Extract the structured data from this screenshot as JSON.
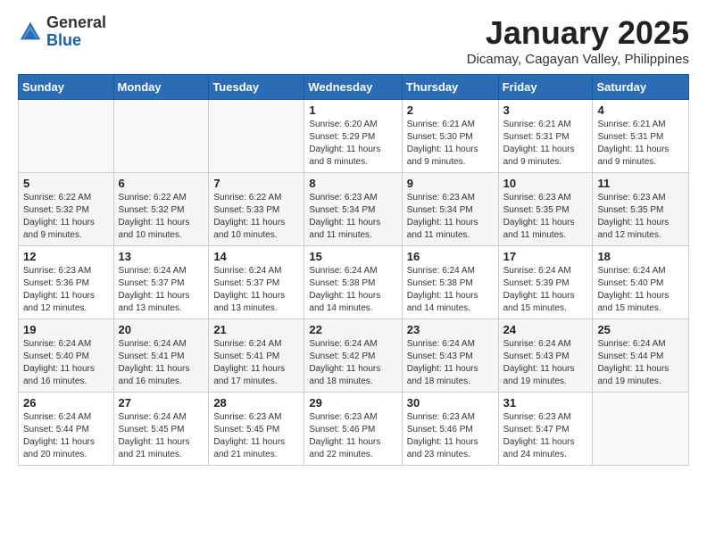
{
  "header": {
    "logo_general": "General",
    "logo_blue": "Blue",
    "month_title": "January 2025",
    "location": "Dicamay, Cagayan Valley, Philippines"
  },
  "days_of_week": [
    "Sunday",
    "Monday",
    "Tuesday",
    "Wednesday",
    "Thursday",
    "Friday",
    "Saturday"
  ],
  "weeks": [
    [
      {
        "day": "",
        "info": ""
      },
      {
        "day": "",
        "info": ""
      },
      {
        "day": "",
        "info": ""
      },
      {
        "day": "1",
        "info": "Sunrise: 6:20 AM\nSunset: 5:29 PM\nDaylight: 11 hours\nand 8 minutes."
      },
      {
        "day": "2",
        "info": "Sunrise: 6:21 AM\nSunset: 5:30 PM\nDaylight: 11 hours\nand 9 minutes."
      },
      {
        "day": "3",
        "info": "Sunrise: 6:21 AM\nSunset: 5:31 PM\nDaylight: 11 hours\nand 9 minutes."
      },
      {
        "day": "4",
        "info": "Sunrise: 6:21 AM\nSunset: 5:31 PM\nDaylight: 11 hours\nand 9 minutes."
      }
    ],
    [
      {
        "day": "5",
        "info": "Sunrise: 6:22 AM\nSunset: 5:32 PM\nDaylight: 11 hours\nand 9 minutes."
      },
      {
        "day": "6",
        "info": "Sunrise: 6:22 AM\nSunset: 5:32 PM\nDaylight: 11 hours\nand 10 minutes."
      },
      {
        "day": "7",
        "info": "Sunrise: 6:22 AM\nSunset: 5:33 PM\nDaylight: 11 hours\nand 10 minutes."
      },
      {
        "day": "8",
        "info": "Sunrise: 6:23 AM\nSunset: 5:34 PM\nDaylight: 11 hours\nand 11 minutes."
      },
      {
        "day": "9",
        "info": "Sunrise: 6:23 AM\nSunset: 5:34 PM\nDaylight: 11 hours\nand 11 minutes."
      },
      {
        "day": "10",
        "info": "Sunrise: 6:23 AM\nSunset: 5:35 PM\nDaylight: 11 hours\nand 11 minutes."
      },
      {
        "day": "11",
        "info": "Sunrise: 6:23 AM\nSunset: 5:35 PM\nDaylight: 11 hours\nand 12 minutes."
      }
    ],
    [
      {
        "day": "12",
        "info": "Sunrise: 6:23 AM\nSunset: 5:36 PM\nDaylight: 11 hours\nand 12 minutes."
      },
      {
        "day": "13",
        "info": "Sunrise: 6:24 AM\nSunset: 5:37 PM\nDaylight: 11 hours\nand 13 minutes."
      },
      {
        "day": "14",
        "info": "Sunrise: 6:24 AM\nSunset: 5:37 PM\nDaylight: 11 hours\nand 13 minutes."
      },
      {
        "day": "15",
        "info": "Sunrise: 6:24 AM\nSunset: 5:38 PM\nDaylight: 11 hours\nand 14 minutes."
      },
      {
        "day": "16",
        "info": "Sunrise: 6:24 AM\nSunset: 5:38 PM\nDaylight: 11 hours\nand 14 minutes."
      },
      {
        "day": "17",
        "info": "Sunrise: 6:24 AM\nSunset: 5:39 PM\nDaylight: 11 hours\nand 15 minutes."
      },
      {
        "day": "18",
        "info": "Sunrise: 6:24 AM\nSunset: 5:40 PM\nDaylight: 11 hours\nand 15 minutes."
      }
    ],
    [
      {
        "day": "19",
        "info": "Sunrise: 6:24 AM\nSunset: 5:40 PM\nDaylight: 11 hours\nand 16 minutes."
      },
      {
        "day": "20",
        "info": "Sunrise: 6:24 AM\nSunset: 5:41 PM\nDaylight: 11 hours\nand 16 minutes."
      },
      {
        "day": "21",
        "info": "Sunrise: 6:24 AM\nSunset: 5:41 PM\nDaylight: 11 hours\nand 17 minutes."
      },
      {
        "day": "22",
        "info": "Sunrise: 6:24 AM\nSunset: 5:42 PM\nDaylight: 11 hours\nand 18 minutes."
      },
      {
        "day": "23",
        "info": "Sunrise: 6:24 AM\nSunset: 5:43 PM\nDaylight: 11 hours\nand 18 minutes."
      },
      {
        "day": "24",
        "info": "Sunrise: 6:24 AM\nSunset: 5:43 PM\nDaylight: 11 hours\nand 19 minutes."
      },
      {
        "day": "25",
        "info": "Sunrise: 6:24 AM\nSunset: 5:44 PM\nDaylight: 11 hours\nand 19 minutes."
      }
    ],
    [
      {
        "day": "26",
        "info": "Sunrise: 6:24 AM\nSunset: 5:44 PM\nDaylight: 11 hours\nand 20 minutes."
      },
      {
        "day": "27",
        "info": "Sunrise: 6:24 AM\nSunset: 5:45 PM\nDaylight: 11 hours\nand 21 minutes."
      },
      {
        "day": "28",
        "info": "Sunrise: 6:23 AM\nSunset: 5:45 PM\nDaylight: 11 hours\nand 21 minutes."
      },
      {
        "day": "29",
        "info": "Sunrise: 6:23 AM\nSunset: 5:46 PM\nDaylight: 11 hours\nand 22 minutes."
      },
      {
        "day": "30",
        "info": "Sunrise: 6:23 AM\nSunset: 5:46 PM\nDaylight: 11 hours\nand 23 minutes."
      },
      {
        "day": "31",
        "info": "Sunrise: 6:23 AM\nSunset: 5:47 PM\nDaylight: 11 hours\nand 24 minutes."
      },
      {
        "day": "",
        "info": ""
      }
    ]
  ]
}
